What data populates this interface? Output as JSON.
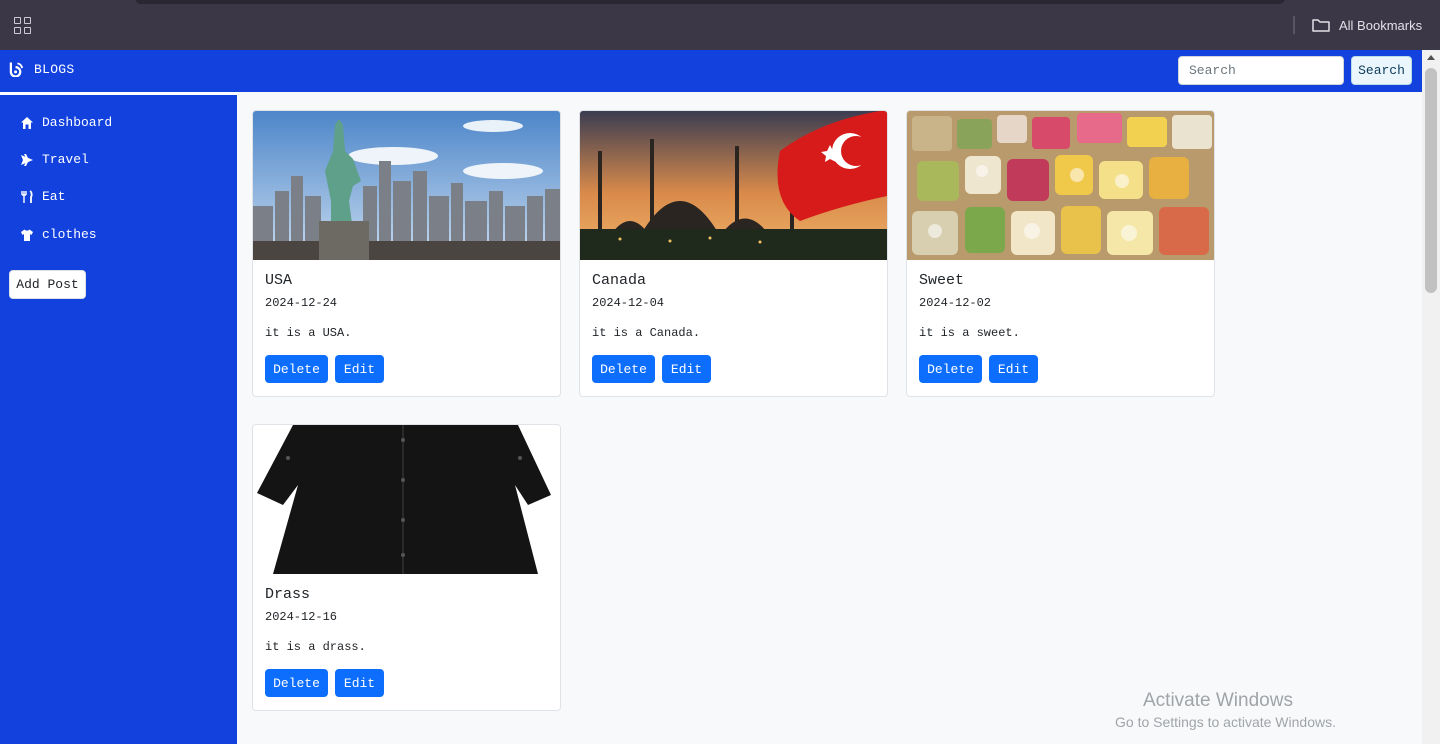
{
  "browser": {
    "bookmarks_label": "All Bookmarks"
  },
  "navbar": {
    "brand": "BLOGS",
    "search_placeholder": "Search",
    "search_button": "Search",
    "accent_color": "#1241de"
  },
  "sidebar": {
    "items": [
      {
        "label": "Dashboard",
        "icon": "home-icon"
      },
      {
        "label": "Travel",
        "icon": "plane-icon"
      },
      {
        "label": "Eat",
        "icon": "utensils-icon"
      },
      {
        "label": "clothes",
        "icon": "shirt-icon"
      }
    ],
    "add_post": "Add Post"
  },
  "posts": [
    {
      "title": "USA",
      "date": "2024-12-24",
      "text": "it is a USA.",
      "image": "statue-of-liberty-skyline"
    },
    {
      "title": "Canada",
      "date": "2024-12-04",
      "text": "it is a Canada.",
      "image": "mosque-with-red-flag"
    },
    {
      "title": "Sweet",
      "date": "2024-12-02",
      "text": "it is a sweet.",
      "image": "colorful-sweets"
    },
    {
      "title": "Drass",
      "date": "2024-12-16",
      "text": "it is a drass.",
      "image": "black-shirt"
    }
  ],
  "card_actions": {
    "delete": "Delete",
    "edit": "Edit"
  },
  "watermark": {
    "title": "Activate Windows",
    "subtitle": "Go to Settings to activate Windows."
  }
}
